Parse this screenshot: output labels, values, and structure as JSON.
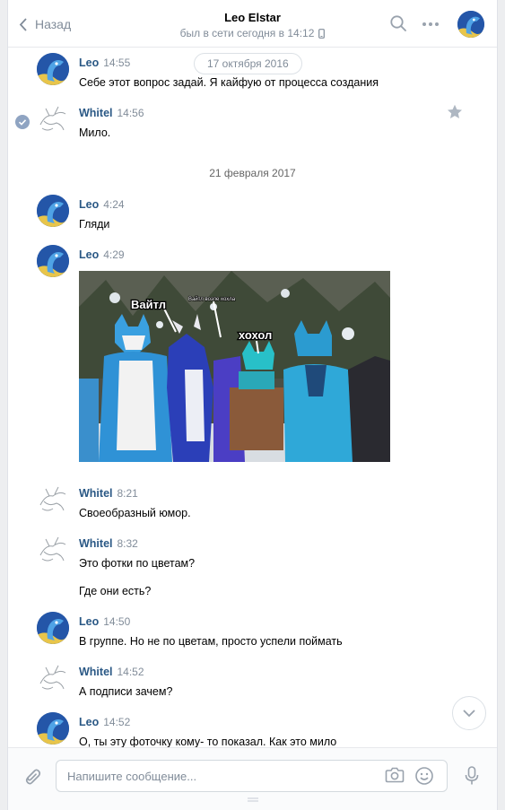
{
  "header": {
    "back_label": "Назад",
    "title": "Leo Elstar",
    "status": "был в сети сегодня в 14:12"
  },
  "history": {
    "floating_date": "17 октября 2016",
    "date_separator": "21 февраля 2017",
    "messages": [
      {
        "author": "Leo",
        "time": "14:55",
        "text": "Себе этот вопрос задай. Я кайфую от процесса создания"
      },
      {
        "author": "Whitel",
        "time": "14:56",
        "text": "Мило."
      },
      {
        "author": "Leo",
        "time": "4:24",
        "text": "Гляди"
      },
      {
        "author": "Leo",
        "time": "4:29"
      },
      {
        "author": "Whitel",
        "time": "8:21",
        "text": "Своеобразный юмор."
      },
      {
        "author": "Whitel",
        "time": "8:32",
        "text": "Это фотки по цветам?",
        "text2": "Где они есть?"
      },
      {
        "author": "Leo",
        "time": "14:50",
        "text": "В группе. Но не по цветам, просто успели поймать"
      },
      {
        "author": "Whitel",
        "time": "14:52",
        "text": "А подписи зачем?"
      },
      {
        "author": "Leo",
        "time": "14:52",
        "text": "О, ты эту фоточку кому- то показал. Как это мило"
      }
    ],
    "photo_captions": {
      "left": "Вайтл",
      "middle": "Вайтл возле хохла",
      "right": "хохол"
    }
  },
  "composer": {
    "placeholder": "Напишите сообщение..."
  },
  "colors": {
    "link": "#2a5885",
    "secondary": "#818c99",
    "accent": "#5181b8"
  }
}
